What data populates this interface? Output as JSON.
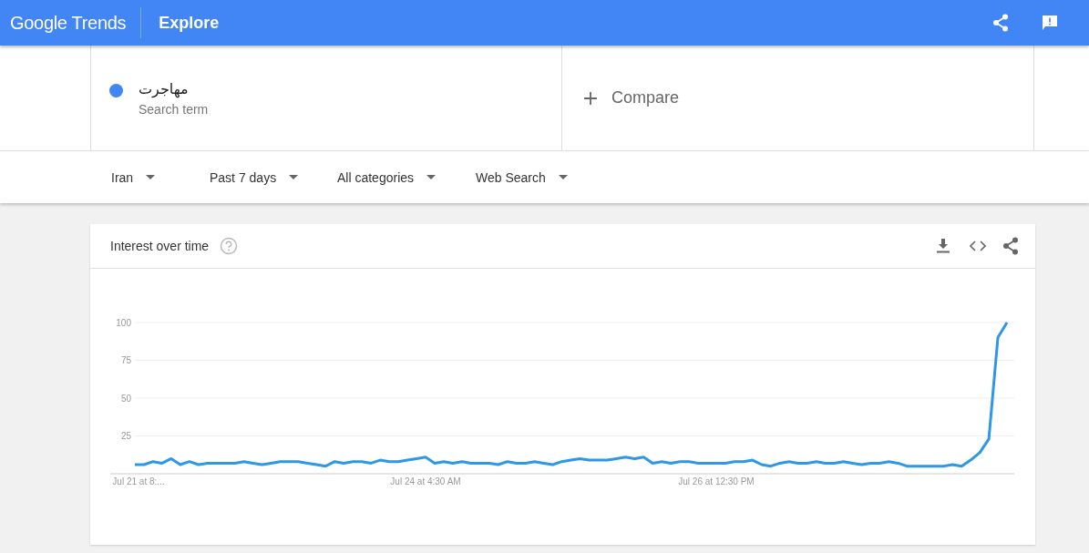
{
  "header": {
    "logo": "Google Trends",
    "title": "Explore"
  },
  "search_terms": [
    {
      "term": "مهاجرت",
      "label": "Search term",
      "color": "#4285f4"
    }
  ],
  "compare": {
    "label": "Compare"
  },
  "filters": [
    {
      "label": "Iran"
    },
    {
      "label": "Past 7 days"
    },
    {
      "label": "All categories"
    },
    {
      "label": "Web Search"
    }
  ],
  "card": {
    "title": "Interest over time",
    "x_axis_labels": [
      "Jul 21 at 8:...",
      "Jul 24 at 4:30 AM",
      "Jul 26 at 12:30 PM"
    ],
    "chart_data": {
      "type": "line",
      "grid": true,
      "ylim": [
        0,
        100
      ],
      "yticks": [
        25,
        50,
        75,
        100
      ],
      "series": [
        {
          "color": "#2d97e8",
          "values": [
            6,
            6,
            8,
            7,
            10,
            6,
            8,
            6,
            7,
            7,
            7,
            7,
            8,
            7,
            6,
            7,
            8,
            8,
            8,
            7,
            6,
            5,
            8,
            7,
            8,
            8,
            7,
            9,
            8,
            8,
            9,
            10,
            11,
            7,
            8,
            7,
            8,
            7,
            7,
            7,
            6,
            8,
            7,
            7,
            8,
            7,
            6,
            8,
            9,
            10,
            9,
            9,
            9,
            10,
            11,
            10,
            11,
            7,
            8,
            7,
            8,
            8,
            7,
            7,
            7,
            7,
            8,
            8,
            9,
            6,
            5,
            7,
            8,
            7,
            7,
            8,
            7,
            7,
            8,
            7,
            6,
            7,
            7,
            8,
            7,
            5,
            5,
            5,
            5,
            5,
            6,
            5,
            9,
            14,
            23,
            90,
            100
          ]
        }
      ]
    }
  }
}
